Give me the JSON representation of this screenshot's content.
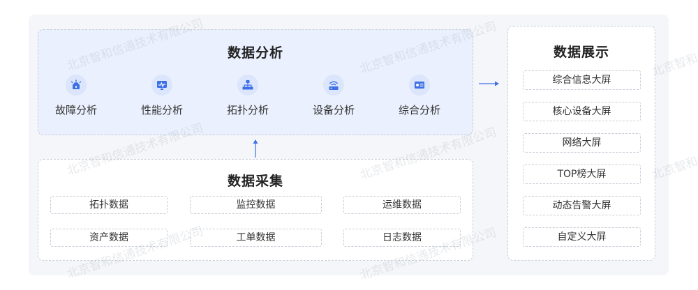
{
  "analysis": {
    "title": "数据分析",
    "items": [
      {
        "label": "故障分析",
        "icon": "alarm-icon"
      },
      {
        "label": "性能分析",
        "icon": "monitor-chart-icon"
      },
      {
        "label": "拓扑分析",
        "icon": "topology-icon"
      },
      {
        "label": "设备分析",
        "icon": "router-icon"
      },
      {
        "label": "综合分析",
        "icon": "dashboard-icon"
      }
    ]
  },
  "collection": {
    "title": "数据采集",
    "items": [
      "拓扑数据",
      "监控数据",
      "运维数据",
      "资产数据",
      "工单数据",
      "日志数据"
    ]
  },
  "display": {
    "title": "数据展示",
    "items": [
      "综合信息大屏",
      "核心设备大屏",
      "网络大屏",
      "TOP榜大屏",
      "动态告警大屏",
      "自定义大屏"
    ]
  },
  "watermark": "北京智和信通技术有限公司",
  "colors": {
    "accent": "#3d6fe6",
    "icon_bg": "#dbe5fb",
    "analysis_bg": "#eaf0fd",
    "panel_bg": "#f4f6f9"
  }
}
